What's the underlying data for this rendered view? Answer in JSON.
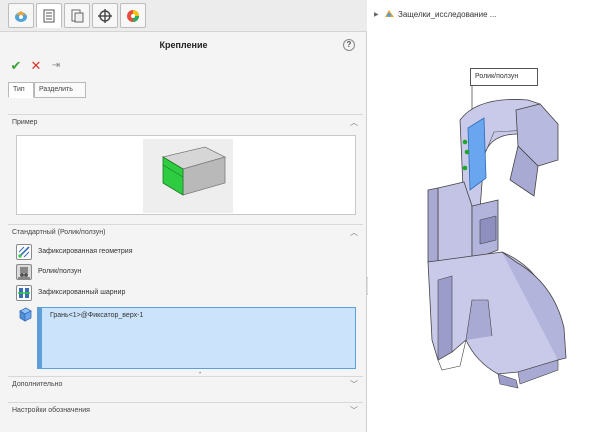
{
  "panel": {
    "title": "Крепление",
    "help_symbol": "?",
    "actions": {
      "ok": "✔",
      "cancel": "✕",
      "pin": "⇥"
    },
    "tabs": [
      "Тип",
      "Разделить"
    ],
    "example_section": {
      "title": "Пример"
    },
    "standard_section": {
      "title": "Стандартный (Ролик/ползун)",
      "options": [
        "Зафиксированная геометрия",
        "Ролик/ползун",
        "Зафиксированный шарнир"
      ]
    },
    "selection": {
      "items": [
        "Грань<1>@Фиксатор_верх-1"
      ],
      "grip": "•"
    },
    "collapsed_sections": [
      "Дополнительно",
      "Настройки обозначения"
    ]
  },
  "graphics": {
    "tree_label": "Защелки_исследование ...",
    "callout": "Ролик/ползун"
  },
  "colors": {
    "selection_fill": "#cbe4fb",
    "selection_border": "#5f9fd8",
    "ok_green": "#3aa335",
    "cancel_red": "#d8322b",
    "model_fill": "#c9cae9",
    "highlight_face": "#6aa6ef",
    "marker_green": "#1fa62b"
  },
  "icons": {
    "tabs": [
      "feature-manager-icon",
      "property-manager-icon",
      "configuration-manager-icon",
      "dimxpert-icon",
      "display-manager-icon"
    ],
    "options": [
      "fixed-geometry-icon",
      "roller-slider-icon",
      "fixed-hinge-icon"
    ],
    "selection": "face-selection-icon"
  }
}
